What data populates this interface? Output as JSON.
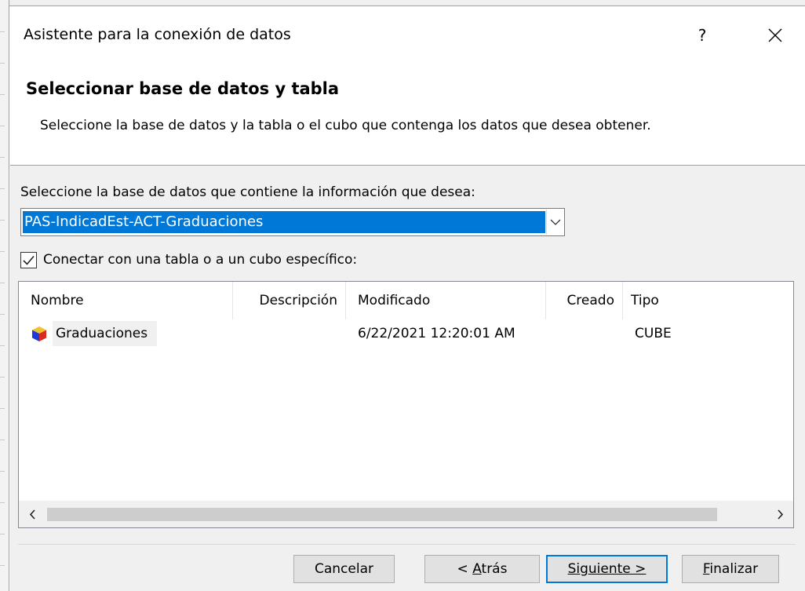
{
  "window": {
    "title": "Asistente para la conexión de datos",
    "help_label": "?"
  },
  "header": {
    "title": "Seleccionar base de datos y tabla",
    "description": "Seleccione la base de datos y la tabla o el cubo que contenga los datos que desea obtener."
  },
  "database": {
    "label": "Seleccione la base de datos que contiene la información que desea:",
    "selected_value": "PAS-IndicadEst-ACT-Graduaciones"
  },
  "specific_table": {
    "label": "Conectar con una tabla o a un cubo específico:",
    "checked": true
  },
  "table": {
    "columns": [
      "Nombre",
      "Descripción",
      "Modificado",
      "Creado",
      "Tipo"
    ],
    "rows": [
      {
        "icon": "cube-icon",
        "nombre": "Graduaciones",
        "descripcion": "",
        "modificado": "6/22/2021 12:20:01 AM",
        "creado": "",
        "tipo": "CUBE"
      }
    ]
  },
  "buttons": {
    "cancel": "Cancelar",
    "back_prefix": "< ",
    "back_underlined": "A",
    "back_rest": "trás",
    "next_underlined": "S",
    "next_rest": "iguiente >",
    "finish_underlined": "F",
    "finish_rest": "inalizar"
  },
  "colors": {
    "accent": "#0078d7",
    "body_background": "#f0f0f0",
    "button_background": "#e1e1e1"
  }
}
